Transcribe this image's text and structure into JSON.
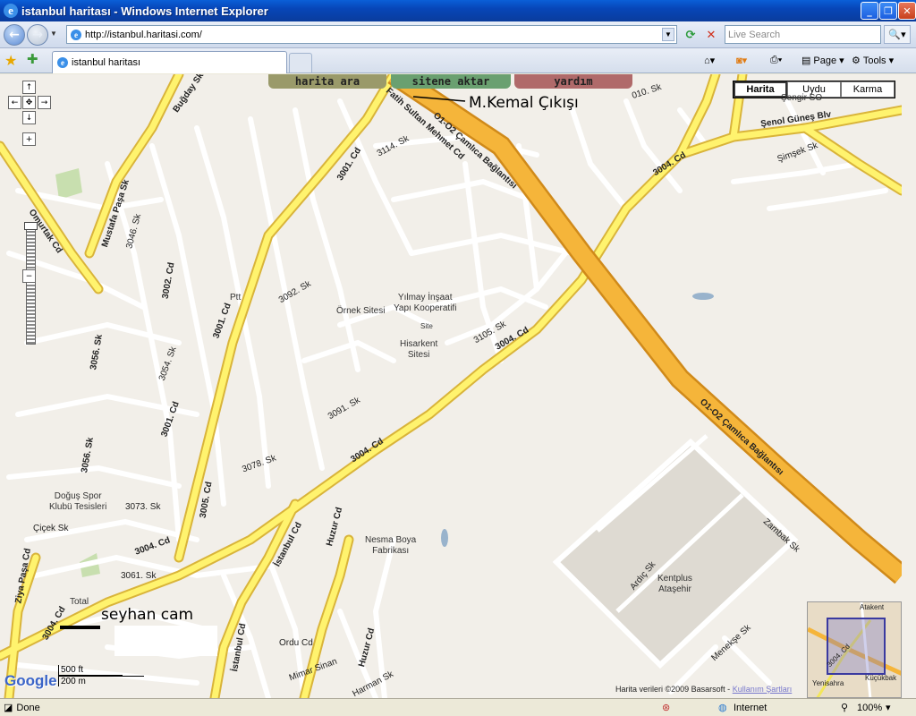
{
  "window": {
    "title": "istanbul haritası - Windows Internet Explorer"
  },
  "toolbar": {
    "url": "http://istanbul.haritasi.com/",
    "search_placeholder": "Live Search"
  },
  "tabs": [
    {
      "label": "istanbul haritası"
    }
  ],
  "commands": {
    "page": "Page",
    "tools": "Tools"
  },
  "site_buttons": {
    "search": "harita ara",
    "export": "sitene aktar",
    "help": "yardım"
  },
  "map_types": [
    {
      "label": "Harita",
      "selected": true
    },
    {
      "label": "Uydu",
      "selected": false
    },
    {
      "label": "Karma",
      "selected": false
    }
  ],
  "annotations": {
    "exit": "M.Kemal Çıkışı",
    "company": "seyhan cam"
  },
  "places": {
    "sengir": "Şengir SO",
    "ornek": "Örnek Sitesi",
    "yilmay": "Yılmay İnşaat\nYapı Kooperatifi",
    "hisarkent": "Hisarkent\nSitesi",
    "dogus": "Doğuş Spor\nKlubü Tesisleri",
    "nesma": "Nesma Boya\nFabrikası",
    "kentplus": "Kentplus\nAtaşehir",
    "total": "Total",
    "ptt": "Ptt",
    "site": "Site"
  },
  "roads": {
    "highway1": "O1-O2 Çamlıca Bağlantısı",
    "highway2": "O1-O2 Çamlıca Bağlantısı",
    "fatih": "Fatih Sultan Mehmet Cd",
    "senol": "Şenol Güneş Blv",
    "r3004a": "3004. Cd",
    "r3004b": "3004. Cd",
    "r3004c": "3004. Cd",
    "r3004d": "3004. Cd",
    "r3004e": "3004. Cd",
    "r3001a": "3001. Cd",
    "r3001b": "3001. Cd",
    "r3001c": "3001. Cd",
    "r3056": "3056. Sk",
    "r3056b": "3056. Sk",
    "r3002": "3002. Cd",
    "r3005": "3005. Cd",
    "mustafa": "Mustafa Paşa Sk",
    "omurtak": "Omurtak Cd",
    "istanbul1": "İstanbul Cd",
    "istanbul2": "İstanbul Cd",
    "huzur1": "Huzur Cd",
    "huzur2": "Huzur Cd",
    "bugday": "Buğday Sk",
    "ziya": "Ziya Paşa Cd",
    "r3046": "3046. Sk",
    "harman": "Harman Sk",
    "mimar": "Mimar Sinan",
    "ordu": "Ordu Cd",
    "cicek": "Çiçek Sk",
    "simsek": "Şimşek Sk",
    "r3010": "010. Sk",
    "menekse": "Menekşe Sk",
    "zambak": "Zambak Sk",
    "ardic": "Ardıç Sk",
    "r3114": "3114. Sk",
    "r3092": "3092. Sk",
    "r3091": "3091. Sk",
    "r3105": "3105. Sk",
    "r3078": "3078. Sk",
    "r3073": "3073. Sk",
    "r3061": "3061. Sk",
    "r3054": "3054. Sk"
  },
  "overview": {
    "labels": {
      "atakent": "Atakent",
      "kucukbak": "Küçükbak",
      "yenisahra": "Yenisahra",
      "cd": "3004. Cd"
    }
  },
  "scale": {
    "ft": "500 ft",
    "m": "200 m"
  },
  "logo": "Google",
  "copyright": {
    "text": "Harita verileri ©2009 Basarsoft -",
    "link": "Kullanım Şartları"
  },
  "status": {
    "text": "Done",
    "zone": "Internet",
    "zoom": "100%"
  }
}
